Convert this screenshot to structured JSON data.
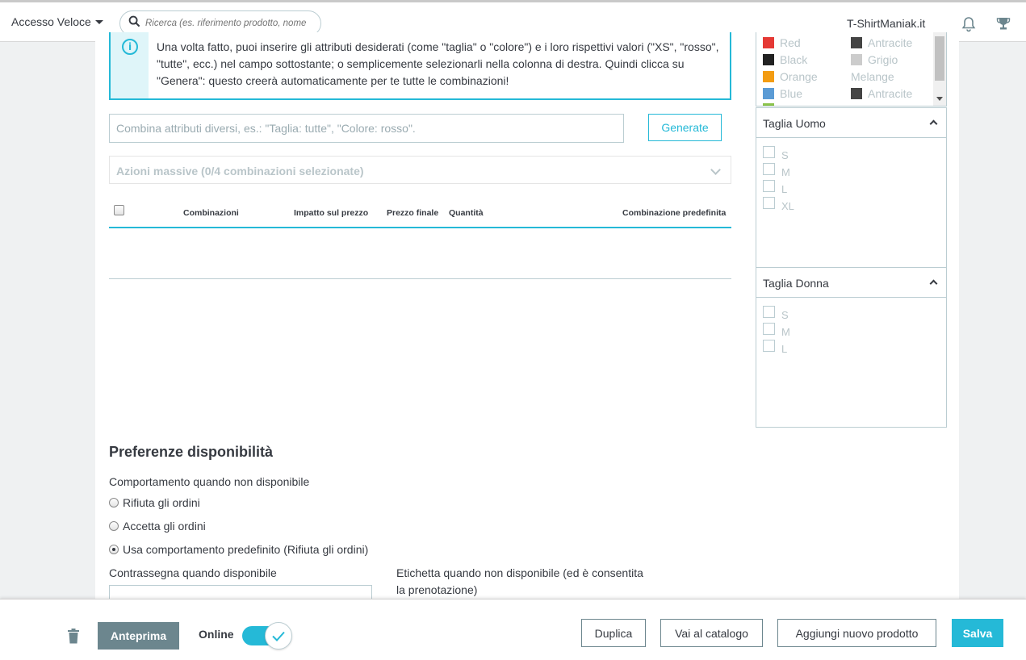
{
  "topbar": {
    "quick_access": "Accesso Veloce",
    "search_placeholder": "Ricerca (es. riferimento prodotto, nome",
    "shop_name": "T-ShirtManiak.it"
  },
  "info": {
    "text": "Una volta fatto, puoi inserire gli attributi desiderati (come \"taglia\" o \"colore\") e i loro rispettivi valori (\"XS\", \"rosso\", \"tutte\", ecc.) nel campo sottostante; o semplicemente selezionarli nella colonna di destra. Quindi clicca su \"Genera\": questo creerà automaticamente per te tutte le combinazioni!"
  },
  "combinations": {
    "input_placeholder": "Combina attributi diversi, es.: \"Taglia: tutte\", \"Colore: rosso\".",
    "generate_label": "Generate",
    "bulk_label": "Azioni massive (0/4 combinazioni selezionate)",
    "columns": [
      "Combinazioni",
      "Impatto sul prezzo",
      "Prezzo finale",
      "Quantità",
      "Combinazione predefinita"
    ]
  },
  "colors": {
    "left": [
      {
        "name": "Red",
        "hex": "#e53935"
      },
      {
        "name": "Black",
        "hex": "#222222"
      },
      {
        "name": "Orange",
        "hex": "#f39c12"
      },
      {
        "name": "Blue",
        "hex": "#5b9bd5"
      }
    ],
    "right": [
      {
        "name": "Antracite",
        "hex": "#444444"
      },
      {
        "name": "Grigio",
        "hex": "#cccccc"
      },
      {
        "name": "Melange",
        "hex": ""
      },
      {
        "name": "Antracite",
        "hex": "#444444"
      }
    ]
  },
  "size_men": {
    "title": "Taglia Uomo",
    "options": [
      "S",
      "M",
      "L",
      "XL"
    ]
  },
  "size_women": {
    "title": "Taglia Donna",
    "options": [
      "S",
      "M",
      "L"
    ]
  },
  "availability": {
    "title": "Preferenze disponibilità",
    "behavior_label": "Comportamento quando non disponibile",
    "options": [
      "Rifiuta gli ordini",
      "Accetta gli ordini",
      "Usa comportamento predefinito (Rifiuta gli ordini)"
    ],
    "selected_index": 2,
    "in_stock_label": "Contrassegna quando disponibile",
    "out_of_stock_label_1": "Etichetta quando non disponibile (ed è consentita",
    "out_of_stock_label_2": "la prenotazione)"
  },
  "footer": {
    "preview": "Anteprima",
    "online": "Online",
    "online_enabled": true,
    "duplicate": "Duplica",
    "catalog": "Vai al catalogo",
    "add_new": "Aggiungi nuovo prodotto",
    "save": "Salva"
  }
}
